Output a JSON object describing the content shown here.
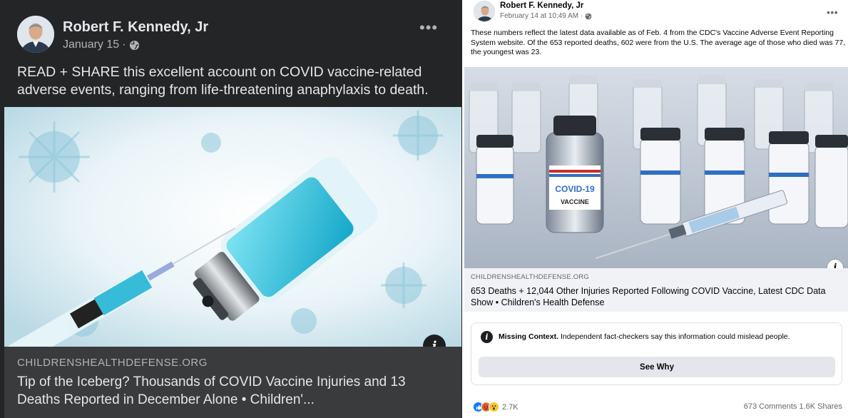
{
  "left_post": {
    "author": "Robert F. Kennedy, Jr",
    "date": "January 15",
    "separator": "·",
    "audience_icon": "globe-icon",
    "text": "READ + SHARE this excellent account on COVID vaccine-related adverse events, ranging from life-threatening anaphylaxis to death.",
    "image": "syringe-and-vaccine-vial-with-virus-particles",
    "link": {
      "domain": "CHILDRENSHEALTHDEFENSE.ORG",
      "headline": "Tip of the Iceberg? Thousands of COVID Vaccine Injuries and 13 Deaths Reported in December Alone • Children'..."
    },
    "info_icon_label": "i",
    "more_icon_label": "•••"
  },
  "right_post": {
    "author": "Robert F. Kennedy, Jr",
    "date": "February 14 at 10:49 AM",
    "separator": "·",
    "audience_icon": "globe-icon",
    "text": "These numbers reflect the latest data available as of Feb. 4 from the CDC's Vaccine Adverse Event Reporting System website. Of the 653 reported deaths, 602 were from the U.S. The average age of those who died was 77, the youngest was 23.",
    "image": "covid-19-vaccine-vials-and-syringe",
    "image_vial_label_top": "COVID-19",
    "image_vial_label_bottom": "VACCINE",
    "link": {
      "domain": "CHILDRENSHEALTHDEFENSE.ORG",
      "headline": "653 Deaths + 12,044 Other Injuries Reported Following COVID Vaccine, Latest CDC Data Show • Children's Health Defense"
    },
    "fact_check": {
      "title": "Missing Context.",
      "message": "Independent fact-checkers say this information could mislead people.",
      "button": "See Why"
    },
    "reactions": {
      "icons": [
        "like-icon",
        "angry-icon",
        "wow-icon"
      ],
      "count": "2.7K"
    },
    "comments": "673 Comments",
    "shares": "1.6K Shares",
    "info_icon_label": "i",
    "more_icon_label": "•••"
  },
  "colors": {
    "dark_bg": "#242526",
    "dark_link_bg": "#3a3b3c",
    "dark_text": "#e4e6eb",
    "dark_secondary": "#b0b3b8",
    "light_link_bg": "#f0f2f5",
    "light_secondary": "#65676b",
    "button_bg": "#e4e6eb",
    "like_blue": "#1877f2"
  }
}
